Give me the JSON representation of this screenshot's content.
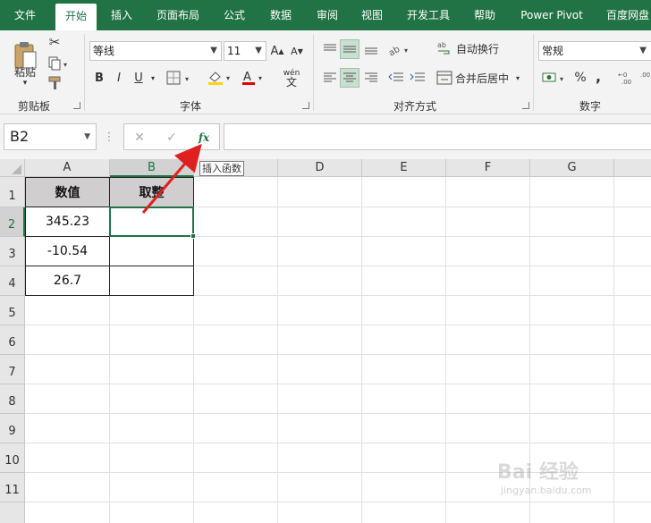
{
  "ribbon": {
    "tabs": [
      {
        "label": "文件",
        "active": false
      },
      {
        "label": "开始",
        "active": true
      },
      {
        "label": "插入",
        "active": false
      },
      {
        "label": "页面布局",
        "active": false
      },
      {
        "label": "公式",
        "active": false
      },
      {
        "label": "数据",
        "active": false
      },
      {
        "label": "审阅",
        "active": false
      },
      {
        "label": "视图",
        "active": false
      },
      {
        "label": "开发工具",
        "active": false
      },
      {
        "label": "帮助",
        "active": false
      },
      {
        "label": "Power Pivot",
        "active": false
      },
      {
        "label": "百度网盘",
        "active": false
      }
    ],
    "clipboard": {
      "paste_label": "粘贴",
      "group_label": "剪贴板"
    },
    "font": {
      "name": "等线",
      "size": "11",
      "bold": "B",
      "italic": "I",
      "underline": "U",
      "grow": "A",
      "shrink": "A",
      "phonetic": "wén",
      "phonetic_char": "文",
      "group_label": "字体"
    },
    "alignment": {
      "wrap_label": "自动换行",
      "merge_label": "合并后居中",
      "group_label": "对齐方式"
    },
    "number": {
      "format": "常规",
      "percent": "%",
      "comma": ",",
      "group_label": "数字"
    },
    "accent_color": "#217346"
  },
  "formula_bar": {
    "name_box": "B2",
    "cancel": "✕",
    "confirm": "✓",
    "fx": "fx",
    "tooltip": "插入函数",
    "formula": ""
  },
  "sheet": {
    "columns": [
      "A",
      "B",
      "C",
      "D",
      "E",
      "F",
      "G"
    ],
    "rows": [
      "1",
      "2",
      "3",
      "4",
      "5",
      "6",
      "7",
      "8",
      "9",
      "10",
      "11"
    ],
    "table": {
      "headers": [
        "数值",
        "取整"
      ],
      "values": [
        "345.23",
        "-10.54",
        "26.7"
      ],
      "header_fill": "#d0cece"
    },
    "selected_cell": "B2"
  },
  "watermark": {
    "brand": "Bai 经验",
    "url": "jingyan.baidu.com"
  }
}
